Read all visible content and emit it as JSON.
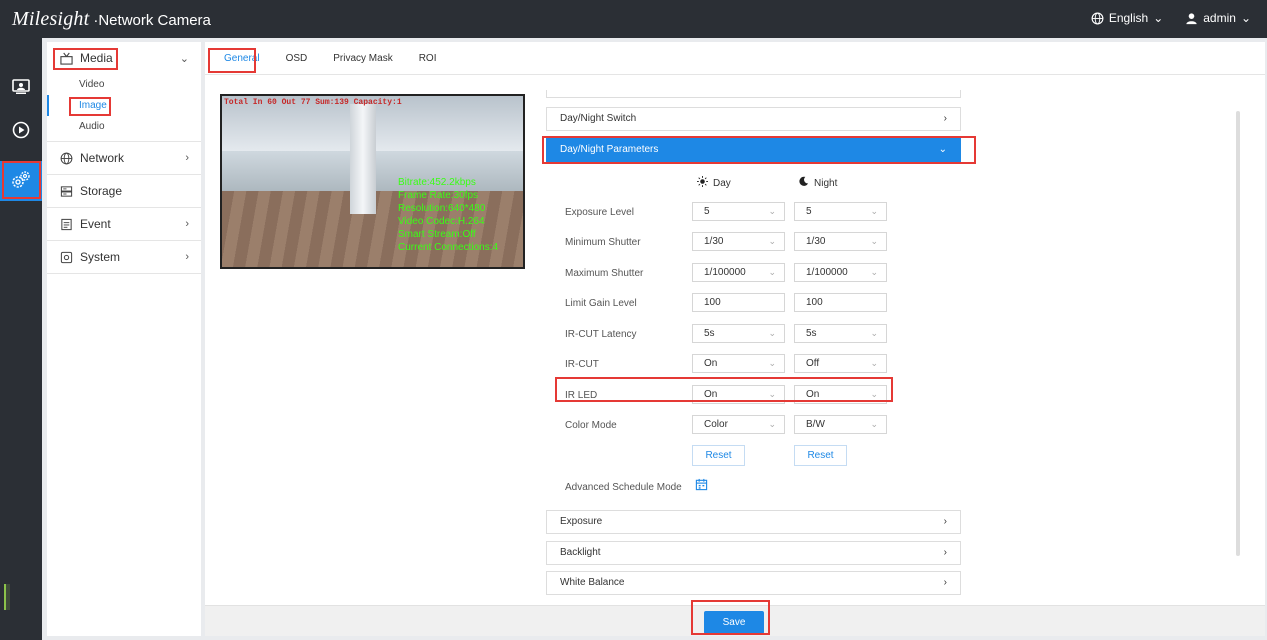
{
  "header": {
    "brand": "Milesight",
    "product": "·Network Camera",
    "language": "English",
    "user": "admin"
  },
  "rail": {
    "items": [
      {
        "icon": "live-view-icon"
      },
      {
        "icon": "playback-icon"
      },
      {
        "icon": "settings-icon",
        "active": true
      }
    ]
  },
  "sidebar": {
    "media": {
      "label": "Media",
      "items": [
        "Video",
        "Image",
        "Audio"
      ]
    },
    "network": {
      "label": "Network"
    },
    "storage": {
      "label": "Storage"
    },
    "event": {
      "label": "Event"
    },
    "system": {
      "label": "System"
    }
  },
  "tabs": [
    "General",
    "OSD",
    "Privacy Mask",
    "ROI"
  ],
  "preview": {
    "osd_top": "Total In 60 Out 77 Sum:139 Capacity:1",
    "osd_lines": [
      "Bitrate:452.2kbps",
      "Frame Rate:30fps",
      "Resolution:640*480",
      "Video Codec:H.264",
      "Smart Stream:Off",
      "Current Connections:4"
    ]
  },
  "sections": {
    "day_night_switch": "Day/Night Switch",
    "day_night_params": "Day/Night Parameters",
    "exposure": "Exposure",
    "backlight": "Backlight",
    "white_balance": "White Balance"
  },
  "columns": {
    "day": "Day",
    "night": "Night"
  },
  "params": [
    {
      "label": "Exposure Level",
      "day": "5",
      "night": "5",
      "dropdown": true
    },
    {
      "label": "Minimum Shutter",
      "day": "1/30",
      "night": "1/30",
      "dropdown": true
    },
    {
      "label": "Maximum Shutter",
      "day": "1/100000",
      "night": "1/100000",
      "dropdown": true
    },
    {
      "label": "Limit Gain Level",
      "day": "100",
      "night": "100",
      "dropdown": false
    },
    {
      "label": "IR-CUT Latency",
      "day": "5s",
      "night": "5s",
      "dropdown": true
    },
    {
      "label": "IR-CUT",
      "day": "On",
      "night": "Off",
      "dropdown": true
    },
    {
      "label": "IR LED",
      "day": "On",
      "night": "On",
      "dropdown": true
    },
    {
      "label": "Color Mode",
      "day": "Color",
      "night": "B/W",
      "dropdown": true
    }
  ],
  "reset_label": "Reset",
  "advanced_schedule_label": "Advanced Schedule Mode",
  "save_label": "Save",
  "colors": {
    "accent": "#1e88e5",
    "highlight": "#e53935",
    "osd_green": "#39ff14"
  }
}
